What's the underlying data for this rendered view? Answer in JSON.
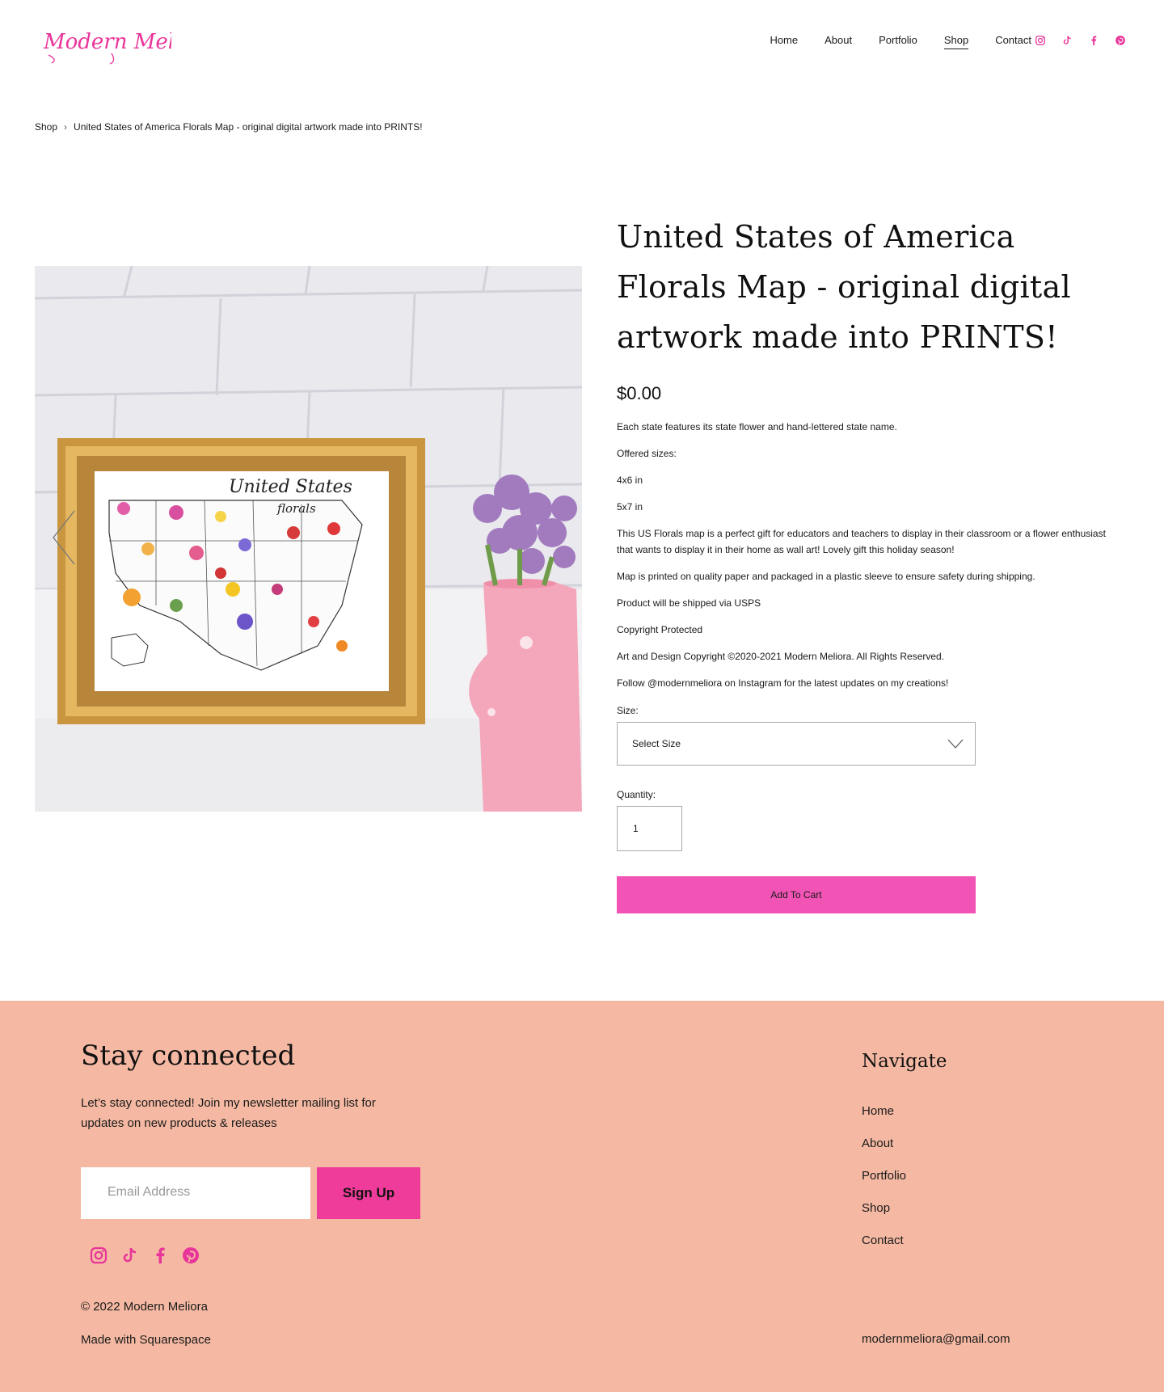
{
  "header": {
    "logo_text": "Modern Meliora",
    "nav": [
      {
        "label": "Home",
        "active": false
      },
      {
        "label": "About",
        "active": false
      },
      {
        "label": "Portfolio",
        "active": false
      },
      {
        "label": "Shop",
        "active": true
      },
      {
        "label": "Contact",
        "active": false
      }
    ],
    "social_icons": [
      "instagram-icon",
      "tiktok-icon",
      "facebook-icon",
      "pinterest-icon"
    ],
    "accent_color": "#e8359a"
  },
  "breadcrumb": {
    "root": "Shop",
    "separator": "›",
    "current": "United States of America Florals Map - original digital artwork made into PRINTS!"
  },
  "product": {
    "image_map_title": "United States",
    "image_map_subtitle": "florals",
    "title": "United States of America Florals Map - original digital artwork made into PRINTS!",
    "price": "$0.00",
    "description": [
      "Each state features its state flower and hand-lettered state name.",
      "Offered sizes:",
      "4x6 in",
      "5x7 in",
      "This US Florals map is a perfect gift for educators and teachers to display in their classroom or a flower enthusiast that wants to display it in their home as wall art! Lovely gift this holiday season!",
      "Map is printed on quality paper and packaged in a plastic sleeve to ensure safety during shipping.",
      "Product will be shipped via USPS",
      "Copyright Protected",
      "Art and Design Copyright ©2020-2021 Modern Meliora. All Rights Reserved.",
      "Follow @modernmeliora on Instagram for the latest updates on my creations!"
    ],
    "size_label": "Size:",
    "size_value": "Select Size",
    "quantity_label": "Quantity:",
    "quantity_value": "1",
    "add_to_cart": "Add To Cart",
    "button_color": "#f154b5"
  },
  "footer": {
    "background": "#f5b9a3",
    "title": "Stay connected",
    "text": "Let’s stay connected! Join my newsletter mailing list for updates on new products & releases",
    "email_placeholder": "Email Address",
    "signup_label": "Sign Up",
    "social_icons": [
      "instagram-icon",
      "tiktok-icon",
      "facebook-icon",
      "pinterest-icon"
    ],
    "copyright": "© 2022 Modern Meliora",
    "made_with": "Made with Squarespace",
    "nav_title": "Navigate",
    "nav": [
      "Home",
      "About",
      "Portfolio",
      "Shop",
      "Contact"
    ],
    "email": "modernmeliora@gmail.com"
  }
}
